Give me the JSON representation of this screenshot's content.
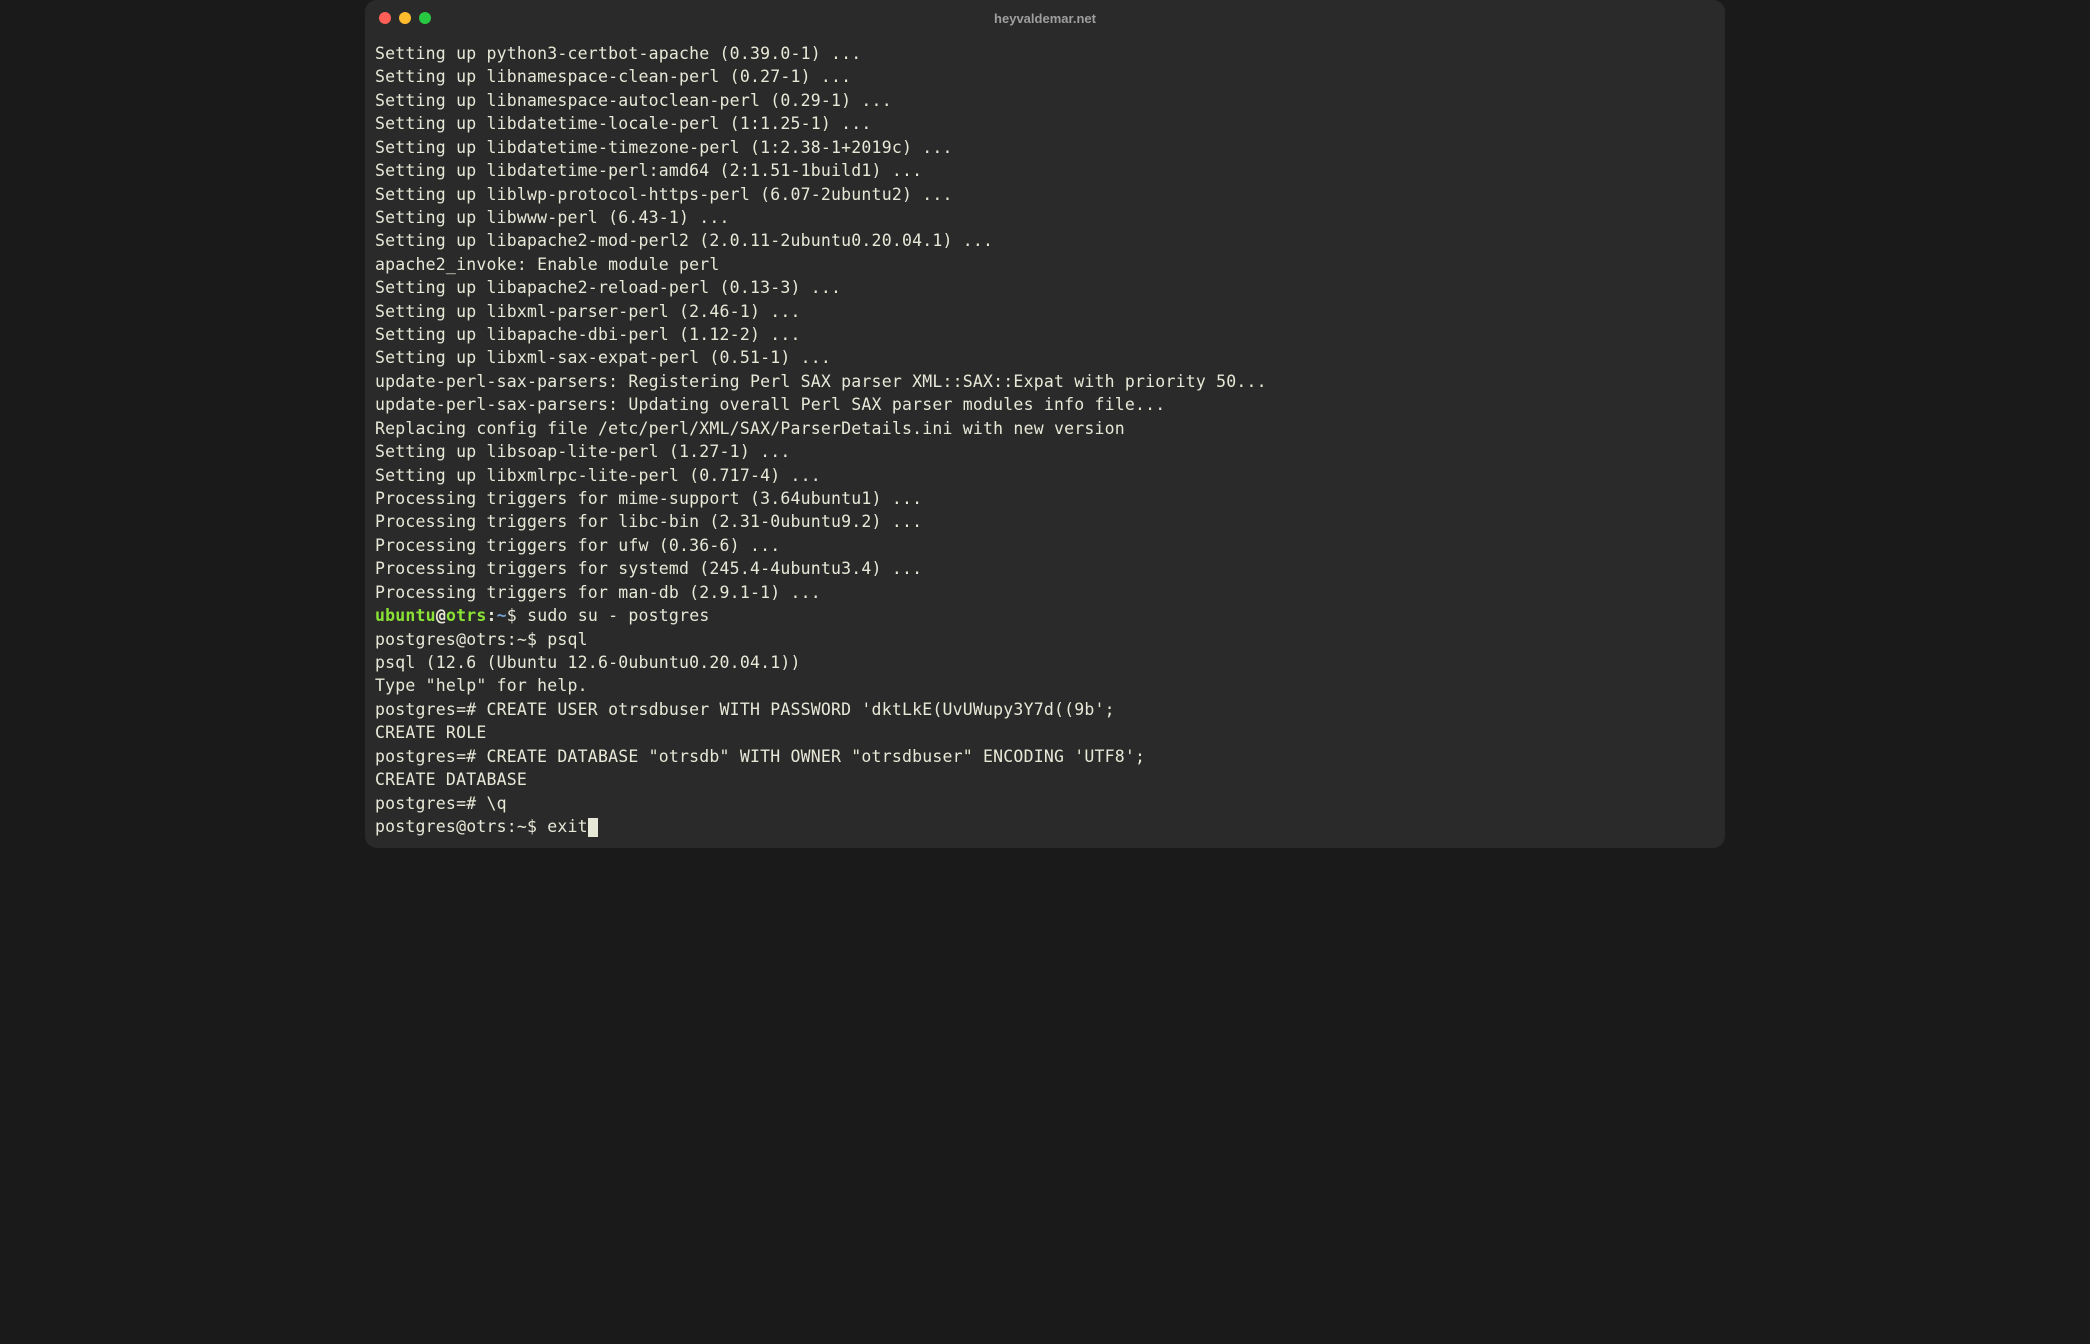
{
  "window": {
    "title": "heyvaldemar.net"
  },
  "output": {
    "lines": [
      "Setting up python3-certbot-apache (0.39.0-1) ...",
      "Setting up libnamespace-clean-perl (0.27-1) ...",
      "Setting up libnamespace-autoclean-perl (0.29-1) ...",
      "Setting up libdatetime-locale-perl (1:1.25-1) ...",
      "Setting up libdatetime-timezone-perl (1:2.38-1+2019c) ...",
      "Setting up libdatetime-perl:amd64 (2:1.51-1build1) ...",
      "Setting up liblwp-protocol-https-perl (6.07-2ubuntu2) ...",
      "Setting up libwww-perl (6.43-1) ...",
      "Setting up libapache2-mod-perl2 (2.0.11-2ubuntu0.20.04.1) ...",
      "apache2_invoke: Enable module perl",
      "Setting up libapache2-reload-perl (0.13-3) ...",
      "Setting up libxml-parser-perl (2.46-1) ...",
      "Setting up libapache-dbi-perl (1.12-2) ...",
      "Setting up libxml-sax-expat-perl (0.51-1) ...",
      "update-perl-sax-parsers: Registering Perl SAX parser XML::SAX::Expat with priority 50...",
      "update-perl-sax-parsers: Updating overall Perl SAX parser modules info file...",
      "Replacing config file /etc/perl/XML/SAX/ParserDetails.ini with new version",
      "Setting up libsoap-lite-perl (1.27-1) ...",
      "Setting up libxmlrpc-lite-perl (0.717-4) ...",
      "Processing triggers for mime-support (3.64ubuntu1) ...",
      "Processing triggers for libc-bin (2.31-0ubuntu9.2) ...",
      "Processing triggers for ufw (0.36-6) ...",
      "Processing triggers for systemd (245.4-4ubuntu3.4) ...",
      "Processing triggers for man-db (2.9.1-1) ..."
    ]
  },
  "prompt1": {
    "user": "ubuntu",
    "host": "otrs",
    "path": "~",
    "symbol": "$",
    "command": "sudo su - postgres"
  },
  "psql": {
    "line1": "postgres@otrs:~$ psql",
    "line2": "psql (12.6 (Ubuntu 12.6-0ubuntu0.20.04.1))",
    "line3": "Type \"help\" for help.",
    "blank": "",
    "create_user": "postgres=# CREATE USER otrsdbuser WITH PASSWORD 'dktLkE(UvUWupy3Y7d((9b';",
    "create_role": "CREATE ROLE",
    "create_db": "postgres=# CREATE DATABASE \"otrsdb\" WITH OWNER \"otrsdbuser\" ENCODING 'UTF8';",
    "create_database": "CREATE DATABASE",
    "quit": "postgres=# \\q",
    "exit_prompt": "postgres@otrs:~$ ",
    "exit_cmd": "exit"
  }
}
